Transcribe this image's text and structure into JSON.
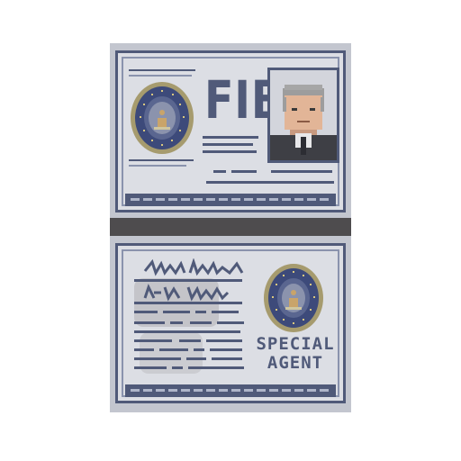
{
  "id_card": {
    "agency_wordmark": "FIB",
    "seal_icon": "agency-seal-icon",
    "portrait": "agent-portrait"
  },
  "badge_card": {
    "title": "SPECIAL AGENT",
    "seal_icon": "agency-seal-icon"
  },
  "colors": {
    "ink": "#505a79",
    "card": "#dcdee4",
    "wallet": "#c3c6cf",
    "fold": "#4e4c4e",
    "seal_ring": "#a69b6e",
    "seal_fill": "#3d4a7a"
  }
}
